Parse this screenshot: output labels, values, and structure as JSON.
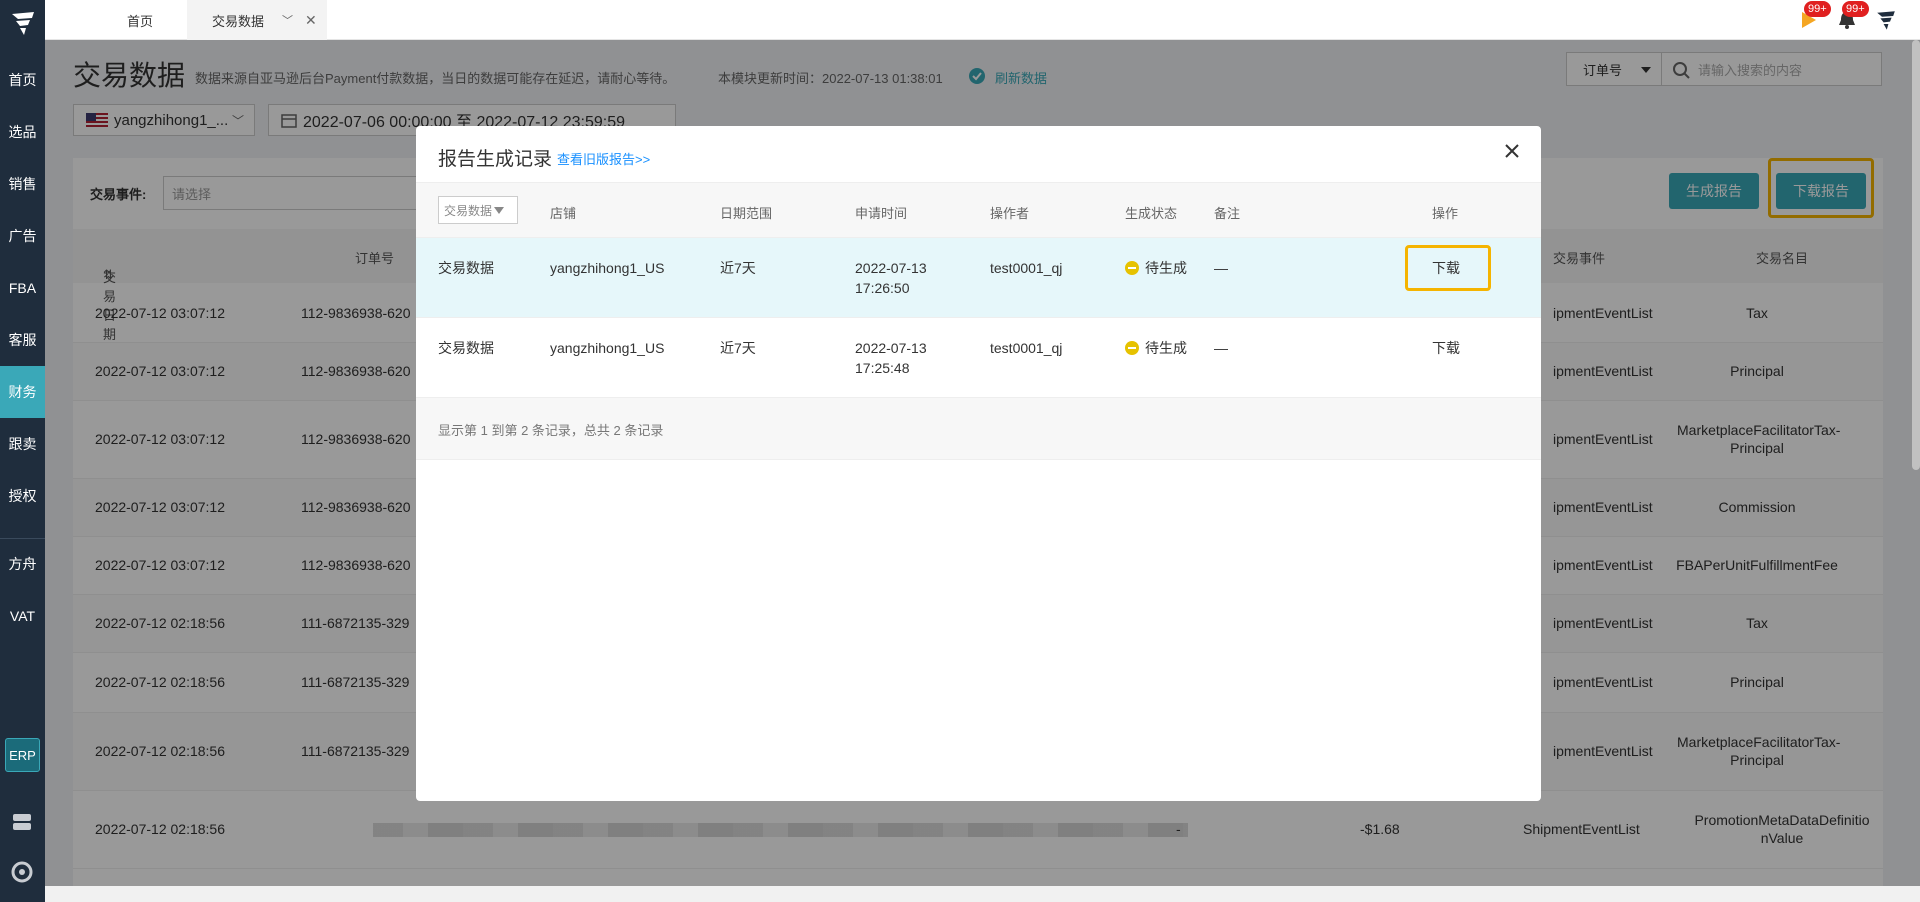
{
  "sidebar": {
    "items": [
      {
        "label": "首页"
      },
      {
        "label": "选品"
      },
      {
        "label": "销售"
      },
      {
        "label": "广告"
      },
      {
        "label": "FBA"
      },
      {
        "label": "客服"
      },
      {
        "label": "财务"
      },
      {
        "label": "跟卖"
      },
      {
        "label": "授权"
      },
      {
        "label": "方舟"
      },
      {
        "label": "VAT"
      }
    ],
    "active_index": 6,
    "erp_label": "ERP"
  },
  "tabs": {
    "home": "首页",
    "current": "交易数据"
  },
  "top_icons": {
    "flag_badge": "99+",
    "bell_badge": "99+"
  },
  "page": {
    "title": "交易数据",
    "description": "数据来源自亚马逊后台Payment付款数据，当日的数据可能存在延迟，请耐心等待。",
    "update_time": "本模块更新时间：2022-07-13 01:38:01",
    "refresh_label": "刷新数据",
    "search_type": "订单号",
    "search_placeholder": "请输入搜索的内容",
    "store": "yangzhihong1_...",
    "date_range": "2022-07-06 00:00:00 至 2022-07-12 23:59:59",
    "filter_label": "交易事件:",
    "filter_placeholder": "请选择",
    "generate_report": "生成报告",
    "download_report": "下载报告"
  },
  "bg_table": {
    "headers": {
      "date": "交易日期",
      "order": "订单号",
      "event": "交易事件",
      "name": "交易名目"
    },
    "rows": [
      {
        "date": "2022-07-12 03:07:12",
        "order": "112-9836938-620",
        "event": "ipmentEventList",
        "name": "Tax"
      },
      {
        "date": "2022-07-12 03:07:12",
        "order": "112-9836938-620",
        "event": "ipmentEventList",
        "name": "Principal"
      },
      {
        "date": "2022-07-12 03:07:12",
        "order": "112-9836938-620",
        "event": "ipmentEventList",
        "name": "MarketplaceFacilitatorTax-Principal"
      },
      {
        "date": "2022-07-12 03:07:12",
        "order": "112-9836938-620",
        "event": "ipmentEventList",
        "name": "Commission"
      },
      {
        "date": "2022-07-12 03:07:12",
        "order": "112-9836938-620",
        "event": "ipmentEventList",
        "name": "FBAPerUnitFulfillmentFee"
      },
      {
        "date": "2022-07-12 02:18:56",
        "order": "111-6872135-329",
        "event": "ipmentEventList",
        "name": "Tax"
      },
      {
        "date": "2022-07-12 02:18:56",
        "order": "111-6872135-329",
        "event": "ipmentEventList",
        "name": "Principal"
      },
      {
        "date": "2022-07-12 02:18:56",
        "order": "111-6872135-329",
        "event": "ipmentEventList",
        "name": "MarketplaceFacilitatorTax-Principal"
      },
      {
        "date": "2022-07-12 02:18:56",
        "order": "",
        "event": "ShipmentEventList",
        "name": "PromotionMetaDataDefinitionValue",
        "dash": "-",
        "amount": "-$1.68"
      }
    ]
  },
  "modal": {
    "title": "报告生成记录",
    "old_reports_link": "查看旧版报告>>",
    "type_filter": "交易数据",
    "headers": {
      "store": "店铺",
      "range": "日期范围",
      "time": "申请时间",
      "operator": "操作者",
      "status": "生成状态",
      "note": "备注",
      "action": "操作"
    },
    "rows": [
      {
        "type": "交易数据",
        "store": "yangzhihong1_US",
        "range": "近7天",
        "date": "2022-07-13",
        "time": "17:26:50",
        "operator": "test0001_qj",
        "status": "待生成",
        "note": "—",
        "action": "下载"
      },
      {
        "type": "交易数据",
        "store": "yangzhihong1_US",
        "range": "近7天",
        "date": "2022-07-13",
        "time": "17:25:48",
        "operator": "test0001_qj",
        "status": "待生成",
        "note": "—",
        "action": "下载"
      }
    ],
    "footer": "显示第 1 到第 2 条记录，总共 2 条记录"
  }
}
